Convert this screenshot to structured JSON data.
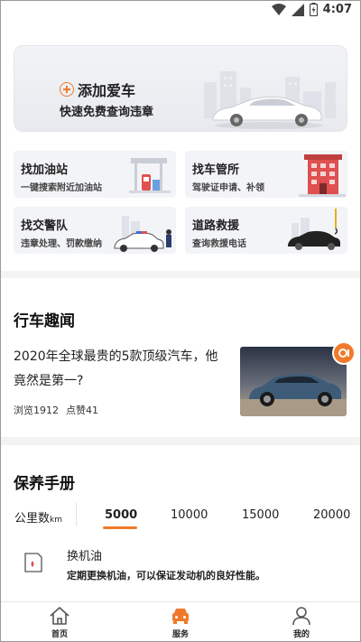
{
  "status_bar": {
    "time": "4:07"
  },
  "banner": {
    "add_car_label": "添加爱车",
    "subtitle": "快速免费查询违章"
  },
  "services": [
    {
      "title": "找加油站",
      "subtitle": "一键搜索附近加油站"
    },
    {
      "title": "找车管所",
      "subtitle": "驾驶证申请、补领"
    },
    {
      "title": "找交警队",
      "subtitle": "违章处理、罚款缴纳"
    },
    {
      "title": "道路救援",
      "subtitle": "查询救援电话"
    }
  ],
  "news": {
    "section_title": "行车趣闻",
    "headline": "2020年全球最贵的5款顶级汽车，他竟然是第一?",
    "views": "浏览1912",
    "likes": "点赞41"
  },
  "maintenance": {
    "section_title": "保养手册",
    "km_label": "公里数",
    "km_unit": "km",
    "km_tabs": [
      "5000",
      "10000",
      "15000",
      "20000"
    ],
    "active_tab": "5000",
    "item": {
      "name": "换机油",
      "description": "定期更换机油，可以保证发动机的良好性能。"
    }
  },
  "bottom_nav": [
    {
      "label": "首页",
      "icon": "home-icon"
    },
    {
      "label": "服务",
      "icon": "car-service-icon"
    },
    {
      "label": "我的",
      "icon": "profile-icon"
    }
  ],
  "colors": {
    "accent": "#f07a2a"
  }
}
